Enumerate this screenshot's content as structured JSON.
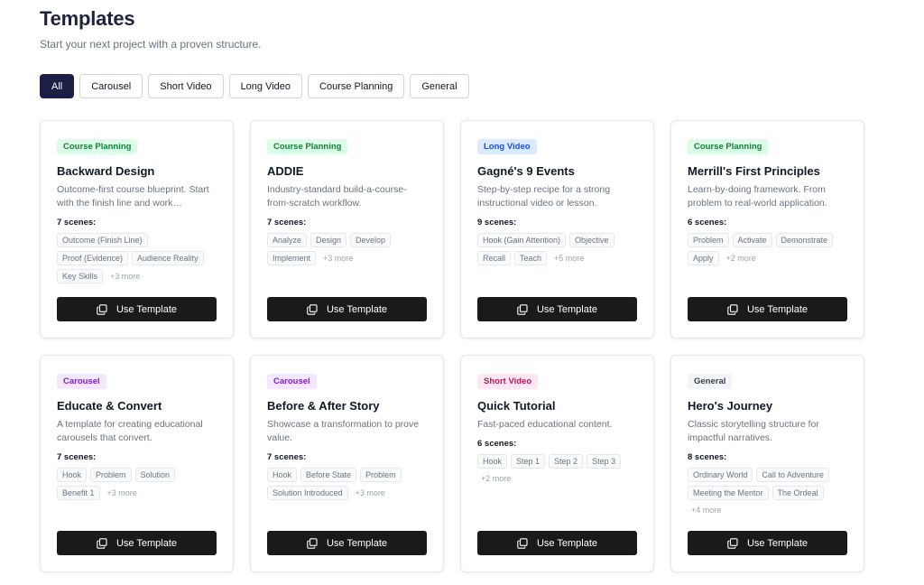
{
  "header": {
    "title": "Templates",
    "subtitle": "Start your next project with a proven structure."
  },
  "filters": [
    {
      "label": "All",
      "active": true
    },
    {
      "label": "Carousel",
      "active": false
    },
    {
      "label": "Short Video",
      "active": false
    },
    {
      "label": "Long Video",
      "active": false
    },
    {
      "label": "Course Planning",
      "active": false
    },
    {
      "label": "General",
      "active": false
    }
  ],
  "use_template_label": "Use Template",
  "cards": [
    {
      "category": "Course Planning",
      "title": "Backward Design",
      "description": "Outcome-first course blueprint. Start with the finish line and work…",
      "scenes_label": "7 scenes:",
      "tags": [
        "Outcome (Finish Line)",
        "Proof (Evidence)",
        "Audience Reality",
        "Key Skills"
      ],
      "more": "+3 more"
    },
    {
      "category": "Course Planning",
      "title": "ADDIE",
      "description": "Industry-standard build-a-course-from-scratch workflow.",
      "scenes_label": "7 scenes:",
      "tags": [
        "Analyze",
        "Design",
        "Develop",
        "Implement"
      ],
      "more": "+3 more"
    },
    {
      "category": "Long Video",
      "title": "Gagné's 9 Events",
      "description": "Step-by-step recipe for a strong instructional video or lesson.",
      "scenes_label": "9 scenes:",
      "tags": [
        "Hook (Gain Attention)",
        "Objective",
        "Recall",
        "Teach"
      ],
      "more": "+5 more"
    },
    {
      "category": "Course Planning",
      "title": "Merrill's First Principles",
      "description": "Learn-by-doing framework. From problem to real-world application.",
      "scenes_label": "6 scenes:",
      "tags": [
        "Problem",
        "Activate",
        "Demonstrate",
        "Apply"
      ],
      "more": "+2 more"
    },
    {
      "category": "Carousel",
      "title": "Educate & Convert",
      "description": "A template for creating educational carousels that convert.",
      "scenes_label": "7 scenes:",
      "tags": [
        "Hook",
        "Problem",
        "Solution",
        "Benefit 1"
      ],
      "more": "+3 more"
    },
    {
      "category": "Carousel",
      "title": "Before & After Story",
      "description": "Showcase a transformation to prove value.",
      "scenes_label": "7 scenes:",
      "tags": [
        "Hook",
        "Before State",
        "Problem",
        "Solution Introduced"
      ],
      "more": "+3 more"
    },
    {
      "category": "Short Video",
      "title": "Quick Tutorial",
      "description": "Fast-paced educational content.",
      "scenes_label": "6 scenes:",
      "tags": [
        "Hook",
        "Step 1",
        "Step 2",
        "Step 3"
      ],
      "more": "+2 more"
    },
    {
      "category": "General",
      "title": "Hero's Journey",
      "description": "Classic storytelling structure for impactful narratives.",
      "scenes_label": "8 scenes:",
      "tags": [
        "Ordinary World",
        "Call to Adventure",
        "Meeting the Mentor",
        "The Ordeal"
      ],
      "more": "+4 more"
    }
  ],
  "colors": {
    "active_filter": "#1b1f45",
    "button": "#1a1a1a",
    "course_planning_badge": "#dcfce7",
    "long_video_badge": "#dbeafe",
    "carousel_badge": "#f3e8ff",
    "short_video_badge": "#fce7f3",
    "general_badge": "#f3f4f6"
  },
  "icons": {
    "use_template": "copy-icon"
  }
}
